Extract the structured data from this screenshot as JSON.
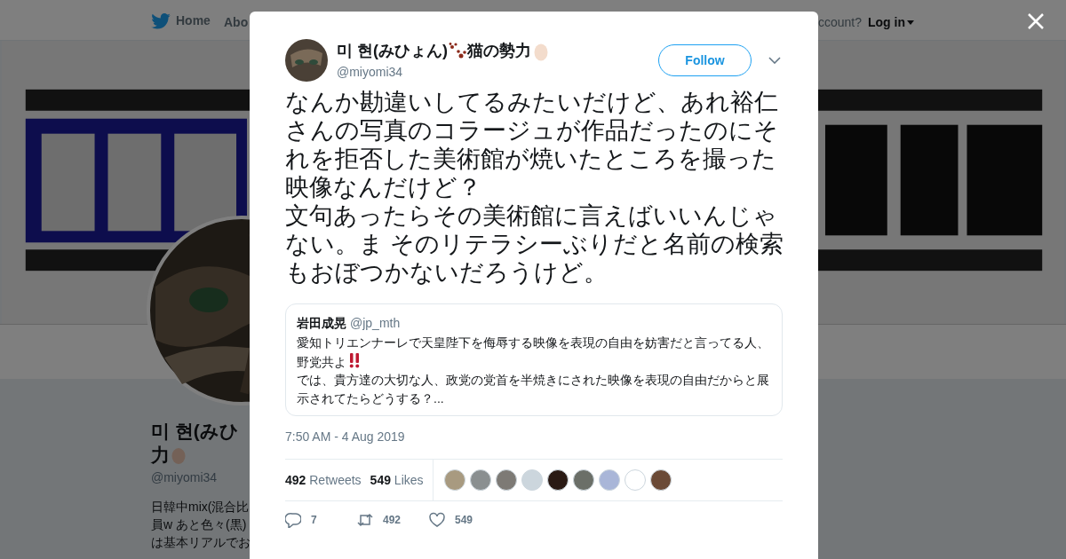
{
  "nav": {
    "home": "Home",
    "about_cut": "Abo",
    "account_cut": "ccount?",
    "login": "Log in"
  },
  "profile": {
    "name_cut": "미 현(みひ",
    "name_line2": "力",
    "handle": "@miyomi34",
    "bio_lines": [
      "日韓中mix(混合比",
      "員w あと色々(黒)",
      "は基本リアルでお"
    ]
  },
  "tweet": {
    "name_parts": [
      "미 현(みひょん)",
      "猫の勢力"
    ],
    "handle": "@miyomi34",
    "follow": "Follow",
    "text": [
      "なんか勘違いしてるみたいだけど、あれ裕仁さんの写真のコラージュが作品だったのにそれを拒否した美術館が焼いたところを撮った映像なんだけど？",
      "文句あったらその美術館に言えばいいんじゃない。ま そのリテラシーぶりだと名前の検索もおぼつかないだろうけど。"
    ],
    "quote": {
      "name": "岩田成晃",
      "handle": "@jp_mth",
      "line1": "愛知トリエンナーレで天皇陛下を侮辱する映像を表現の自由を妨害だと言ってる人、野党共よ",
      "line2": "では、貴方達の大切な人、政党の党首を半焼きにされた映像を表現の自由だからと展示されてたらどうする？..."
    },
    "time": "7:50 AM - 4 Aug 2019",
    "retweets": "492",
    "retweets_label": "Retweets",
    "likes": "549",
    "likes_label": "Likes",
    "likers": [
      {
        "color": "#a89a80"
      },
      {
        "color": "#8a8f90"
      },
      {
        "color": "#7d7a75"
      },
      {
        "color": "#ccd6dd"
      },
      {
        "color": "#2a1a14"
      },
      {
        "color": "#6b6f68"
      },
      {
        "color": "#a9b6d8"
      },
      {
        "color": "#ffffff"
      },
      {
        "color": "#6b4a36"
      }
    ],
    "actions": [
      {
        "kind": "reply",
        "count": "7"
      },
      {
        "kind": "retweet",
        "count": "492"
      },
      {
        "kind": "like",
        "count": "549"
      }
    ]
  }
}
